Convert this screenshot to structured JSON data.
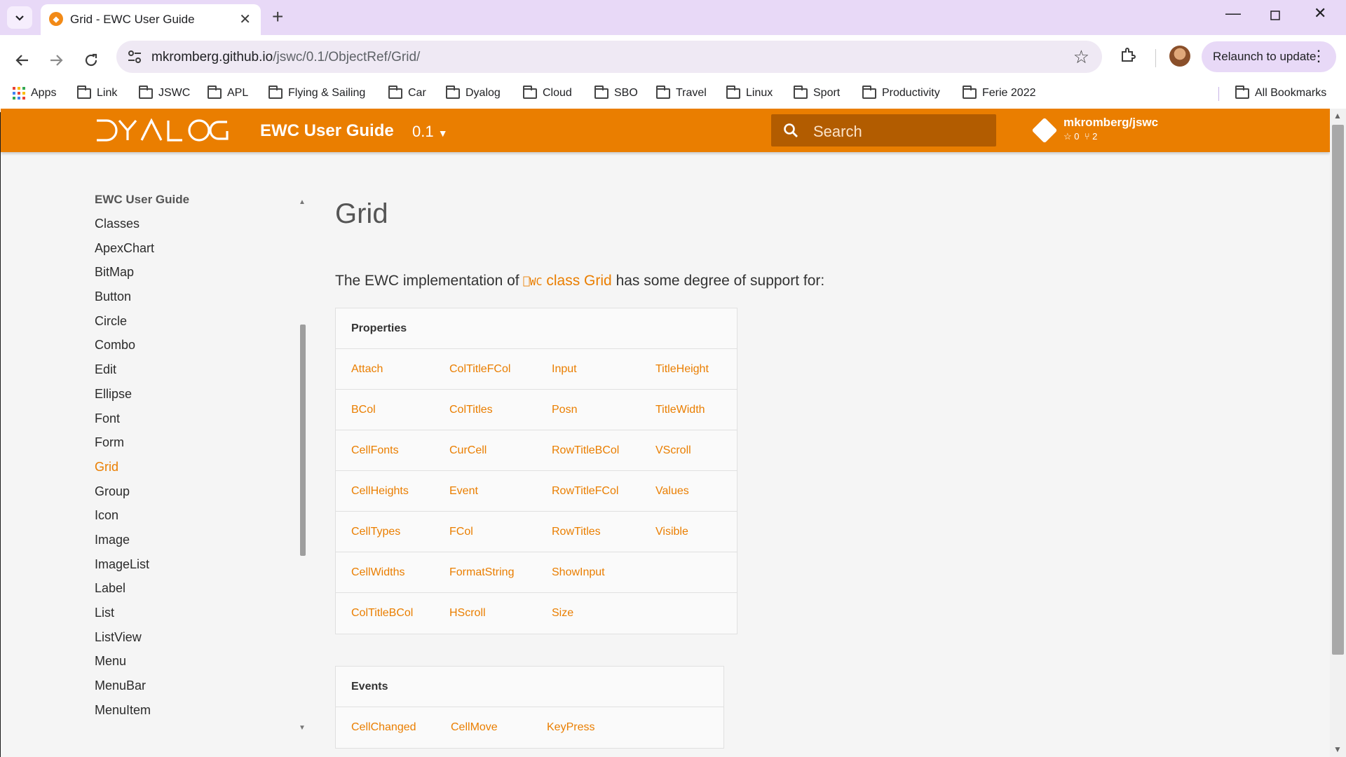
{
  "browser": {
    "tab_title": "Grid - EWC User Guide",
    "url_host": "mkromberg.github.io",
    "url_path": "/jswc/0.1/ObjectRef/Grid/",
    "relaunch_label": "Relaunch to update",
    "bookmarks": [
      "Apps",
      "Link",
      "JSWC",
      "APL",
      "Flying & Sailing",
      "Car",
      "Dyalog",
      "Cloud",
      "SBO",
      "Travel",
      "Linux",
      "Sport",
      "Productivity",
      "Ferie 2022"
    ],
    "all_bookmarks": "All Bookmarks"
  },
  "header": {
    "logo_text": "DYALOG",
    "site_name": "EWC User Guide",
    "version": "0.1",
    "search_placeholder": "Search",
    "repo_name": "mkromberg/jswc",
    "repo_stars": "0",
    "repo_forks": "2"
  },
  "sidebar": {
    "title": "EWC User Guide",
    "items": [
      "Classes",
      "ApexChart",
      "BitMap",
      "Button",
      "Circle",
      "Combo",
      "Edit",
      "Ellipse",
      "Font",
      "Form",
      "Grid",
      "Group",
      "Icon",
      "Image",
      "ImageList",
      "Label",
      "List",
      "ListView",
      "Menu",
      "MenuBar",
      "MenuItem"
    ],
    "active": "Grid"
  },
  "main": {
    "title": "Grid",
    "intro_before": "The EWC implementation of ",
    "intro_code": "⎕WC",
    "intro_link": "class Grid",
    "intro_after": " has some degree of support for:",
    "properties": {
      "heading": "Properties",
      "rows": [
        [
          "Attach",
          "ColTitleFCol",
          "Input",
          "TitleHeight"
        ],
        [
          "BCol",
          "ColTitles",
          "Posn",
          "TitleWidth"
        ],
        [
          "CellFonts",
          "CurCell",
          "RowTitleBCol",
          "VScroll"
        ],
        [
          "CellHeights",
          "Event",
          "RowTitleFCol",
          "Values"
        ],
        [
          "CellTypes",
          "FCol",
          "RowTitles",
          "Visible"
        ],
        [
          "CellWidths",
          "FormatString",
          "ShowInput",
          ""
        ],
        [
          "ColTitleBCol",
          "HScroll",
          "Size",
          ""
        ]
      ]
    },
    "events": {
      "heading": "Events",
      "rows": [
        [
          "CellChanged",
          "CellMove",
          "KeyPress"
        ]
      ]
    }
  },
  "colors": {
    "accent": "#ea7e00",
    "header_bg": "#ea7e00",
    "search_bg": "#b25c00",
    "tabbar_bg": "#e8d9f7"
  },
  "icons": {
    "back": "arrow-left-icon",
    "forward": "arrow-right-icon",
    "reload": "reload-icon",
    "star": "star-icon",
    "extensions": "puzzle-icon",
    "menu": "more-vert-icon",
    "search": "search-icon",
    "repo": "git-icon"
  }
}
